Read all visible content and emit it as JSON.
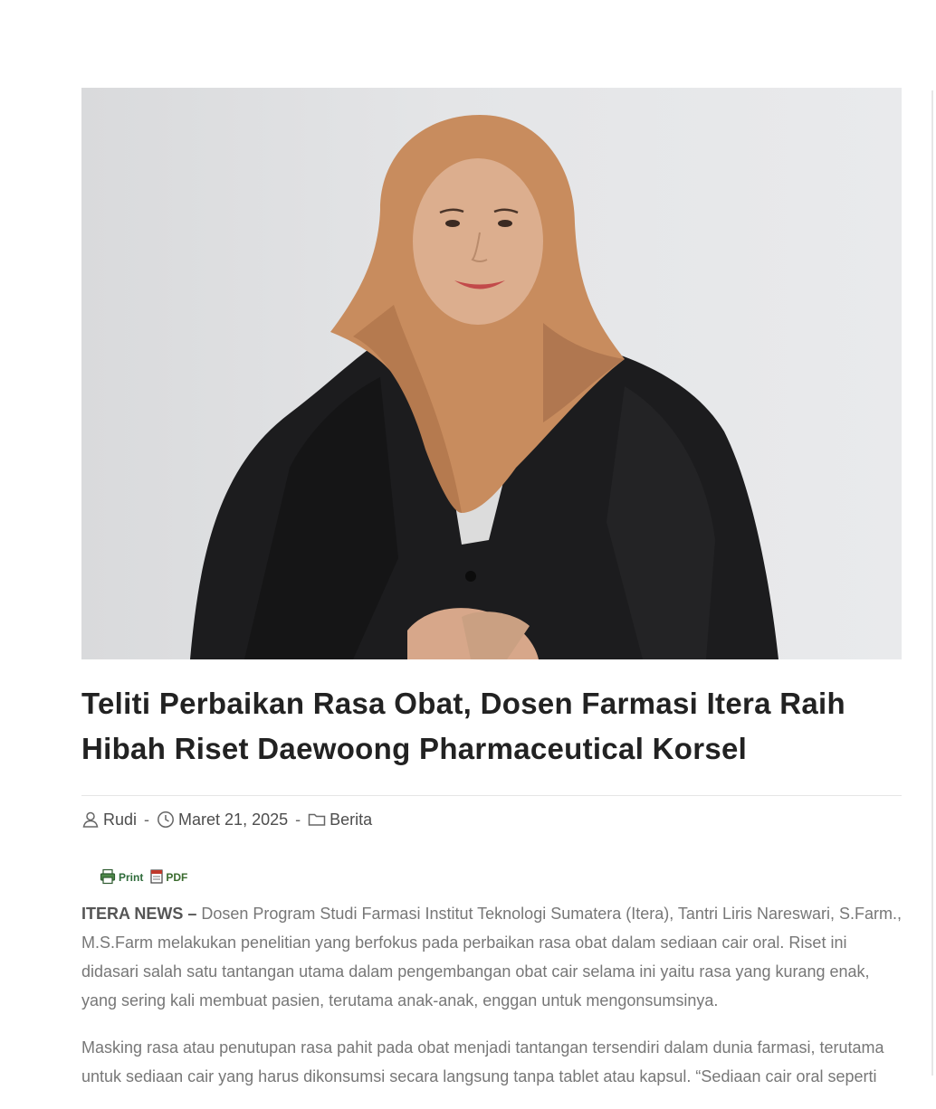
{
  "article": {
    "title": "Teliti Perbaikan Rasa Obat, Dosen Farmasi Itera Raih Hibah Riset Daewoong Pharmaceutical Korsel",
    "meta": {
      "author": "Rudi",
      "date": "Maret 21, 2025",
      "category": "Berita",
      "separator": "-"
    },
    "print_label": "Print",
    "pdf_label": "PDF",
    "lead": "ITERA NEWS –",
    "paragraph1": " Dosen Program Studi Farmasi Institut Teknologi Sumatera (Itera), Tantri Liris Nareswari, S.Farm., M.S.Farm melakukan penelitian yang berfokus pada perbaikan rasa obat dalam sediaan cair oral. Riset ini didasari salah satu tantangan utama dalam pengembangan obat cair selama ini yaitu rasa yang kurang enak, yang sering kali membuat pasien, terutama anak-anak, enggan untuk mengonsumsinya.",
    "paragraph2": "Masking rasa atau penutupan rasa pahit pada obat menjadi tantangan tersendiri dalam dunia farmasi, terutama untuk sediaan cair yang harus dikonsumsi secara langsung tanpa tablet atau kapsul. “Sediaan cair oral seperti"
  },
  "icons": {
    "author": "user-icon",
    "date": "clock-icon",
    "category": "folder-icon",
    "print": "printer-icon",
    "pdf": "pdf-icon"
  }
}
